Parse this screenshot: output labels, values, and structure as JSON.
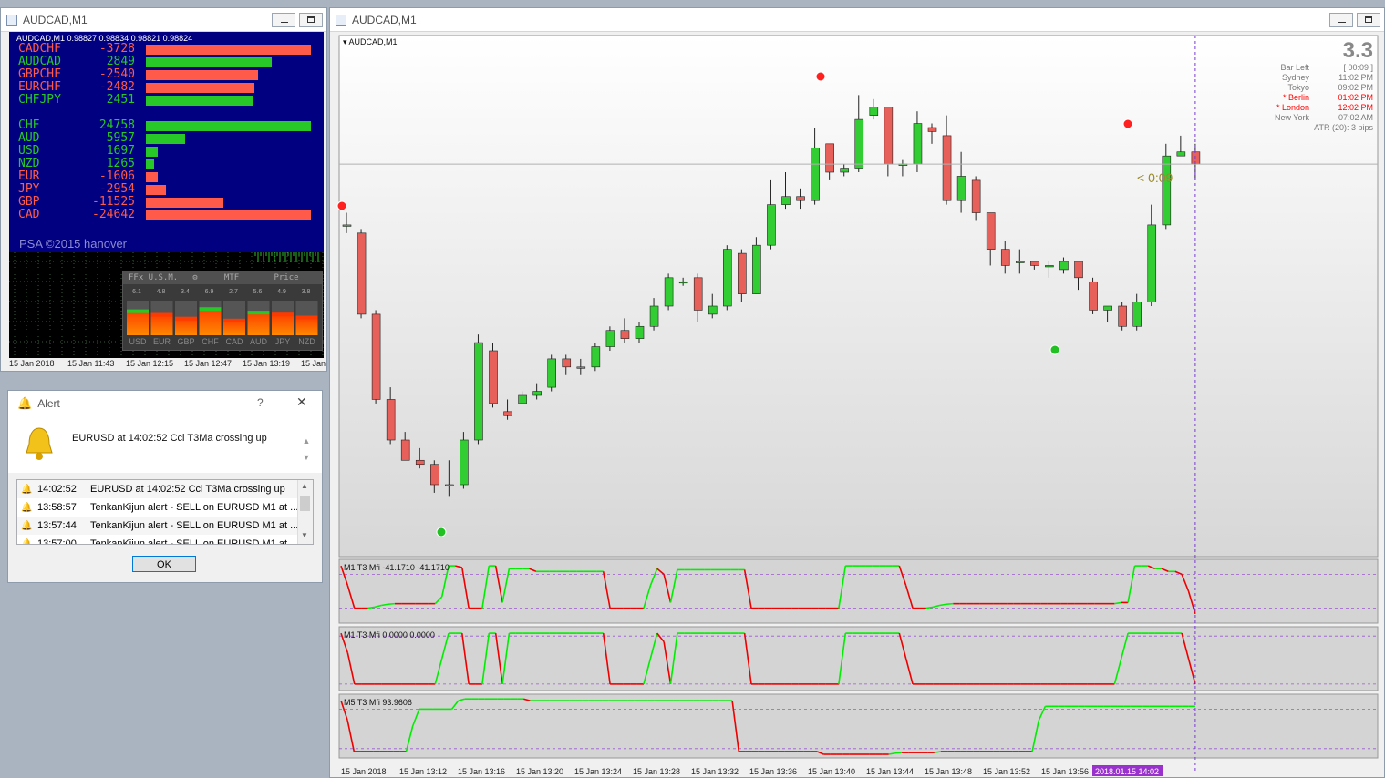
{
  "left_window": {
    "title": "AUDCAD,M1",
    "header_text": "AUDCAD,M1  0.98827 0.98834 0.98821 0.98824",
    "pairs": [
      {
        "name": "CADCHF",
        "value": "-3728",
        "bar": 1.0,
        "color": "#ff5a4a"
      },
      {
        "name": "AUDCAD",
        "value": "2849",
        "bar": 0.76,
        "color": "#28c828"
      },
      {
        "name": "GBPCHF",
        "value": "-2540",
        "bar": 0.68,
        "color": "#ff5a4a"
      },
      {
        "name": "EURCHF",
        "value": "-2482",
        "bar": 0.66,
        "color": "#ff5a4a"
      },
      {
        "name": "CHFJPY",
        "value": "2451",
        "bar": 0.65,
        "color": "#28c828"
      }
    ],
    "currencies": [
      {
        "name": "CHF",
        "value": "24758",
        "bar": 1.0,
        "color": "#28c828"
      },
      {
        "name": "AUD",
        "value": "5957",
        "bar": 0.24,
        "color": "#28c828"
      },
      {
        "name": "USD",
        "value": "1697",
        "bar": 0.07,
        "color": "#28c828"
      },
      {
        "name": "NZD",
        "value": "1265",
        "bar": 0.05,
        "color": "#28c828"
      },
      {
        "name": "EUR",
        "value": "-1606",
        "bar": 0.07,
        "color": "#ff5a4a"
      },
      {
        "name": "JPY",
        "value": "-2954",
        "bar": 0.12,
        "color": "#ff5a4a"
      },
      {
        "name": "GBP",
        "value": "-11525",
        "bar": 0.47,
        "color": "#ff5a4a"
      },
      {
        "name": "CAD",
        "value": "-24642",
        "bar": 1.0,
        "color": "#ff5a4a"
      }
    ],
    "credit": "PSA ©2015 hanover",
    "ffx_header": [
      "FFx U.S.M.",
      "MTF",
      "Price"
    ],
    "ffx_values": [
      "6.1",
      "4.8",
      "3.4",
      "6.9",
      "2.7",
      "5.6",
      "4.9",
      "3.8"
    ],
    "ffx_levels": [
      0.61,
      0.48,
      0.34,
      0.69,
      0.27,
      0.56,
      0.49,
      0.38
    ],
    "ffx_currencies": [
      "USD",
      "EUR",
      "GBP",
      "CHF",
      "CAD",
      "AUD",
      "JPY",
      "NZD"
    ],
    "time_labels": [
      "15 Jan 2018",
      "15 Jan 11:43",
      "15 Jan 12:15",
      "15 Jan 12:47",
      "15 Jan 13:19",
      "15 Jan"
    ]
  },
  "alert": {
    "title": "Alert",
    "help": "?",
    "message": "EURUSD at 14:02:52 Cci T3Ma crossing up",
    "log": [
      {
        "time": "14:02:52",
        "text": "EURUSD at 14:02:52 Cci T3Ma crossing up"
      },
      {
        "time": "13:58:57",
        "text": "TenkanKijun alert - SELL on EURUSD M1 at ..."
      },
      {
        "time": "13:57:44",
        "text": "TenkanKijun alert - SELL on EURUSD M1 at ..."
      },
      {
        "time": "13:57:00",
        "text": "TenkanKijun alert - SELL on EURUSD M1 at ..."
      }
    ],
    "ok_label": "OK"
  },
  "main_window": {
    "title": "AUDCAD,M1",
    "chart_label": "AUDCAD,M1",
    "atr_big": "3.3",
    "info_rows": [
      {
        "label": "Bar Left",
        "value": "[ 00:09 ]",
        "color": "#777777"
      },
      {
        "label": "Sydney",
        "value": "11:02 PM",
        "color": "#777777"
      },
      {
        "label": "Tokyo",
        "value": "09:02 PM",
        "color": "#777777"
      },
      {
        "label": "* Berlin",
        "value": "01:02 PM",
        "color": "#ff0000"
      },
      {
        "label": "* London",
        "value": "12:02 PM",
        "color": "#ff0000"
      },
      {
        "label": "New York",
        "value": "07:02 AM",
        "color": "#777777"
      }
    ],
    "atr_line": "ATR (20): 3 pips",
    "countdown": "< 0:09",
    "indicator_labels": [
      "M1  T3 Mfi  -41.1710 -41.1710",
      "M1  T3 Mfi  0.0000 0.0000",
      "M5  T3 Mfi  93.9606"
    ],
    "time_labels": [
      "15 Jan 2018",
      "15 Jan 13:12",
      "15 Jan 13:16",
      "15 Jan 13:20",
      "15 Jan 13:24",
      "15 Jan 13:28",
      "15 Jan 13:32",
      "15 Jan 13:36",
      "15 Jan 13:40",
      "15 Jan 13:44",
      "15 Jan 13:48",
      "15 Jan 13:52",
      "15 Jan 13:56"
    ],
    "current_time_label": "2018.01.15 14:02"
  },
  "chart_data": {
    "type": "candlestick",
    "up_color": "#32cd32",
    "down_color": "#e8605a",
    "ylim": [
      0,
      100
    ],
    "candles": [
      [
        75,
        75,
        78,
        73
      ],
      [
        73,
        53,
        74,
        52
      ],
      [
        53,
        32,
        54,
        31
      ],
      [
        32,
        22,
        35,
        21
      ],
      [
        22,
        17,
        24,
        17
      ],
      [
        17,
        16,
        20,
        15
      ],
      [
        16,
        11,
        17,
        9
      ],
      [
        11,
        11,
        17,
        8
      ],
      [
        11,
        22,
        24,
        10
      ],
      [
        22,
        46,
        48,
        21
      ],
      [
        44,
        31,
        46,
        30
      ],
      [
        29,
        28,
        32,
        27
      ],
      [
        31,
        33,
        34,
        31
      ],
      [
        33,
        34,
        36,
        32
      ],
      [
        35,
        42,
        43,
        34
      ],
      [
        42,
        40,
        43,
        38
      ],
      [
        40,
        40,
        42,
        38
      ],
      [
        40,
        45,
        46,
        39
      ],
      [
        45,
        49,
        50,
        44
      ],
      [
        49,
        47,
        52,
        46
      ],
      [
        47,
        50,
        51,
        46
      ],
      [
        50,
        55,
        57,
        49
      ],
      [
        55,
        62,
        63,
        54
      ],
      [
        61,
        61,
        62,
        60
      ],
      [
        62,
        54,
        63,
        51
      ],
      [
        53,
        55,
        58,
        52
      ],
      [
        55,
        69,
        70,
        54
      ],
      [
        68,
        58,
        69,
        56
      ],
      [
        58,
        70,
        72,
        58
      ],
      [
        70,
        80,
        86,
        69
      ],
      [
        80,
        82,
        88,
        79
      ],
      [
        82,
        81,
        84,
        79
      ],
      [
        81,
        94,
        99,
        80
      ],
      [
        95,
        88,
        95,
        86
      ],
      [
        88,
        89,
        90,
        87
      ],
      [
        89,
        101,
        107,
        88
      ],
      [
        102,
        104,
        106,
        101
      ],
      [
        104,
        90,
        104,
        87
      ],
      [
        90,
        90,
        91,
        87
      ],
      [
        90,
        100,
        103,
        88
      ],
      [
        99,
        98,
        100,
        95
      ],
      [
        97,
        81,
        102,
        80
      ],
      [
        81,
        87,
        93,
        78
      ],
      [
        86,
        78,
        87,
        76
      ],
      [
        78,
        69,
        78,
        65
      ],
      [
        69,
        65,
        71,
        63
      ],
      [
        66,
        66,
        69,
        63
      ],
      [
        66,
        65,
        66,
        64
      ],
      [
        65,
        65,
        66,
        62
      ],
      [
        64,
        66,
        67,
        63
      ],
      [
        66,
        62,
        66,
        59
      ],
      [
        61,
        54,
        62,
        53
      ],
      [
        54,
        55,
        55,
        51
      ],
      [
        55,
        50,
        56,
        49
      ],
      [
        50,
        56,
        58,
        49
      ],
      [
        56,
        75,
        80,
        55
      ],
      [
        75,
        92,
        95,
        74
      ],
      [
        92,
        93,
        97,
        92
      ],
      [
        93,
        90,
        95,
        86
      ]
    ],
    "indicator_panels": [
      {
        "name": "T3 Mfi M1",
        "levels": [
          80,
          20
        ],
        "values": [
          95,
          60,
          20,
          20,
          20,
          22,
          25,
          27,
          28,
          28,
          28,
          28,
          28,
          28,
          28,
          40,
          95,
          95,
          92,
          20,
          20,
          20,
          95,
          95,
          30,
          90,
          90,
          90,
          90,
          85,
          85,
          85,
          85,
          85,
          85,
          85,
          85,
          85,
          85,
          85,
          20,
          20,
          20,
          20,
          20,
          20,
          60,
          90,
          80,
          30,
          88,
          88,
          88,
          88,
          88,
          88,
          88,
          88,
          88,
          88,
          88,
          20,
          20,
          20,
          20,
          20,
          20,
          20,
          20,
          20,
          20,
          20,
          20,
          20,
          20,
          95,
          95,
          95,
          95,
          95,
          95,
          95,
          95,
          95,
          60,
          20,
          20,
          20,
          22,
          25,
          27,
          28,
          28,
          28,
          28,
          28,
          28,
          28,
          28,
          28,
          28,
          28,
          28,
          28,
          28,
          28,
          28,
          28,
          28,
          28,
          28,
          28,
          28,
          28,
          28,
          28,
          30,
          30,
          95,
          95,
          95,
          90,
          90,
          85,
          85,
          80,
          50,
          10
        ]
      },
      {
        "name": "T3 Mfi M1",
        "levels": [
          90,
          5
        ],
        "values": [
          95,
          60,
          5,
          5,
          5,
          5,
          5,
          5,
          5,
          5,
          5,
          5,
          5,
          5,
          5,
          50,
          95,
          95,
          95,
          5,
          5,
          5,
          95,
          95,
          5,
          95,
          95,
          95,
          95,
          95,
          95,
          95,
          95,
          95,
          95,
          95,
          95,
          95,
          95,
          95,
          5,
          5,
          5,
          5,
          5,
          5,
          50,
          95,
          80,
          5,
          95,
          95,
          95,
          95,
          95,
          95,
          95,
          95,
          95,
          95,
          95,
          5,
          5,
          5,
          5,
          5,
          5,
          5,
          5,
          5,
          5,
          5,
          5,
          5,
          5,
          95,
          95,
          95,
          95,
          95,
          95,
          95,
          95,
          95,
          50,
          5,
          5,
          5,
          5,
          5,
          5,
          5,
          5,
          5,
          5,
          5,
          5,
          5,
          5,
          5,
          5,
          5,
          5,
          5,
          5,
          5,
          5,
          5,
          5,
          5,
          5,
          5,
          5,
          5,
          5,
          5,
          50,
          95,
          95,
          95,
          95,
          95,
          95,
          95,
          95,
          95,
          50,
          5
        ]
      },
      {
        "name": "T3 Mfi M5",
        "levels": [
          80,
          10
        ],
        "values": [
          95,
          60,
          5,
          5,
          5,
          5,
          5,
          5,
          5,
          5,
          5,
          50,
          80,
          80,
          80,
          80,
          80,
          80,
          95,
          98,
          98,
          98,
          98,
          98,
          98,
          98,
          98,
          98,
          98,
          95,
          95,
          95,
          95,
          95,
          95,
          95,
          95,
          95,
          95,
          95,
          95,
          95,
          95,
          95,
          95,
          95,
          95,
          95,
          95,
          95,
          95,
          95,
          95,
          95,
          95,
          95,
          95,
          95,
          95,
          95,
          95,
          5,
          5,
          5,
          5,
          5,
          5,
          5,
          5,
          5,
          5,
          5,
          5,
          5,
          0,
          0,
          0,
          0,
          0,
          0,
          0,
          0,
          0,
          0,
          0,
          2,
          3,
          3,
          3,
          3,
          3,
          3,
          5,
          5,
          5,
          5,
          5,
          5,
          5,
          5,
          5,
          5,
          5,
          5,
          5,
          5,
          5,
          60,
          85,
          85,
          85,
          85,
          85,
          85,
          85,
          85,
          85,
          85,
          85,
          85,
          85,
          85,
          85,
          85,
          85,
          85,
          85,
          85,
          85,
          85,
          85,
          85
        ]
      }
    ]
  }
}
